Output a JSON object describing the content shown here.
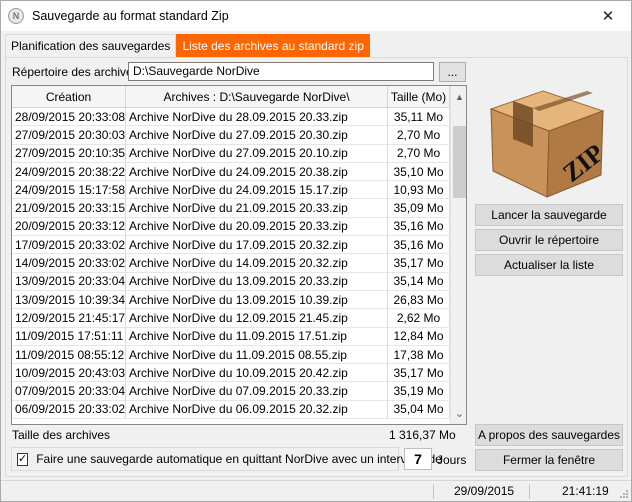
{
  "window": {
    "title": "Sauvegarde au format standard Zip",
    "icon": "nordive-logo-icon",
    "close_symbol": "✕"
  },
  "tabs": [
    {
      "label": "Planification des sauvegardes",
      "active": false
    },
    {
      "label": "Liste des archives au standard zip",
      "active": true
    }
  ],
  "directory": {
    "label": "Répertoire des archives",
    "value": "D:\\Sauvegarde NorDive",
    "browse_label": "..."
  },
  "grid": {
    "columns": [
      "Création",
      "Archives : D:\\Sauvegarde NorDive\\",
      "Taille (Mo)"
    ],
    "rows": [
      [
        "28/09/2015 20:33:08",
        "Archive NorDive du 28.09.2015 20.33.zip",
        "35,11 Mo"
      ],
      [
        "27/09/2015 20:30:03",
        "Archive NorDive du 27.09.2015 20.30.zip",
        "2,70 Mo"
      ],
      [
        "27/09/2015 20:10:35",
        "Archive NorDive du 27.09.2015 20.10.zip",
        "2,70 Mo"
      ],
      [
        "24/09/2015 20:38:22",
        "Archive NorDive du 24.09.2015 20.38.zip",
        "35,10 Mo"
      ],
      [
        "24/09/2015 15:17:58",
        "Archive NorDive du 24.09.2015 15.17.zip",
        "10,93 Mo"
      ],
      [
        "21/09/2015 20:33:15",
        "Archive NorDive du 21.09.2015 20.33.zip",
        "35,09 Mo"
      ],
      [
        "20/09/2015 20:33:12",
        "Archive NorDive du 20.09.2015 20.33.zip",
        "35,16 Mo"
      ],
      [
        "17/09/2015 20:33:02",
        "Archive NorDive du 17.09.2015 20.32.zip",
        "35,16 Mo"
      ],
      [
        "14/09/2015 20:33:02",
        "Archive NorDive du 14.09.2015 20.32.zip",
        "35,17 Mo"
      ],
      [
        "13/09/2015 20:33:04",
        "Archive NorDive du 13.09.2015 20.33.zip",
        "35,14 Mo"
      ],
      [
        "13/09/2015 10:39:34",
        "Archive NorDive du 13.09.2015 10.39.zip",
        "26,83 Mo"
      ],
      [
        "12/09/2015 21:45:17",
        "Archive NorDive du 12.09.2015 21.45.zip",
        "2,62 Mo"
      ],
      [
        "11/09/2015 17:51:11",
        "Archive NorDive du 11.09.2015 17.51.zip",
        "12,84 Mo"
      ],
      [
        "11/09/2015 08:55:12",
        "Archive NorDive du 11.09.2015 08.55.zip",
        "17,38 Mo"
      ],
      [
        "10/09/2015 20:43:03",
        "Archive NorDive du 10.09.2015 20.42.zip",
        "35,17 Mo"
      ],
      [
        "07/09/2015 20:33:04",
        "Archive NorDive du 07.09.2015 20.33.zip",
        "35,19 Mo"
      ],
      [
        "06/09/2015 20:33:02",
        "Archive NorDive du 06.09.2015 20.32.zip",
        "35,04 Mo"
      ]
    ]
  },
  "total": {
    "label": "Taille des archives",
    "value": "1 316,37 Mo"
  },
  "auto_save": {
    "checked": true,
    "label": "Faire une sauvegarde automatique en quittant NorDive avec un intervalle de",
    "days_value": "7",
    "days_unit": "Jours"
  },
  "side_buttons": {
    "start": "Lancer la sauvegarde",
    "open_dir": "Ouvrir le répertoire",
    "refresh": "Actualiser la liste",
    "about": "A propos des sauvegardes",
    "close": "Fermer la fenêtre"
  },
  "zip_image": {
    "icon": "zip-box-icon",
    "text": "ZIP"
  },
  "status": {
    "date": "29/09/2015",
    "time": "21:41:19"
  },
  "colors": {
    "active_tab": "#ff6600",
    "box": "#c8925a"
  }
}
